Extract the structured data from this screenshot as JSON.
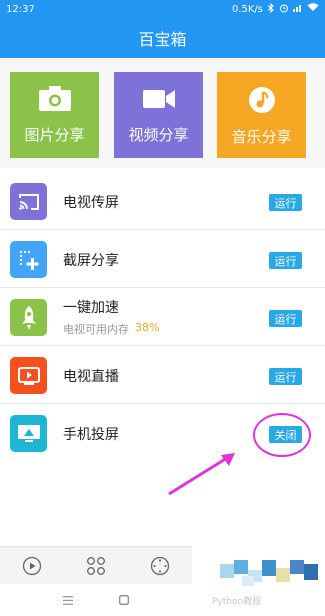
{
  "status_bar": {
    "time": "12:37",
    "network_speed": "0.5K/s",
    "icons": [
      "bluetooth-icon",
      "alarm-icon",
      "signal-icon",
      "wifi-icon"
    ]
  },
  "header": {
    "title": "百宝箱"
  },
  "tiles": [
    {
      "label": "图片分享",
      "icon": "camera-icon",
      "color": "#8bc34a"
    },
    {
      "label": "视频分享",
      "icon": "video-camera-icon",
      "color": "#7e72d8"
    },
    {
      "label": "音乐分享",
      "icon": "music-note-icon",
      "color": "#f5a623"
    }
  ],
  "list": [
    {
      "title": "电视传屏",
      "button": "运行",
      "icon": "cast-icon",
      "color": "#7e72d8"
    },
    {
      "title": "截屏分享",
      "button": "运行",
      "icon": "screenshot-add-icon",
      "color": "#42a5f5"
    },
    {
      "title": "一键加速",
      "subtitle": "电视可用内存",
      "percent": "38%",
      "button": "运行",
      "icon": "rocket-icon",
      "color": "#8bc34a"
    },
    {
      "title": "电视直播",
      "button": "运行",
      "icon": "tv-play-icon",
      "color": "#f4511e"
    },
    {
      "title": "手机投屏",
      "button": "关闭",
      "icon": "monitor-upload-icon",
      "color": "#1fb6d6"
    }
  ],
  "bottom_nav": [
    "play-icon",
    "grid-icon",
    "dial-icon"
  ],
  "system_nav": [
    "menu-icon",
    "home-icon"
  ],
  "watermark": "Python教程"
}
